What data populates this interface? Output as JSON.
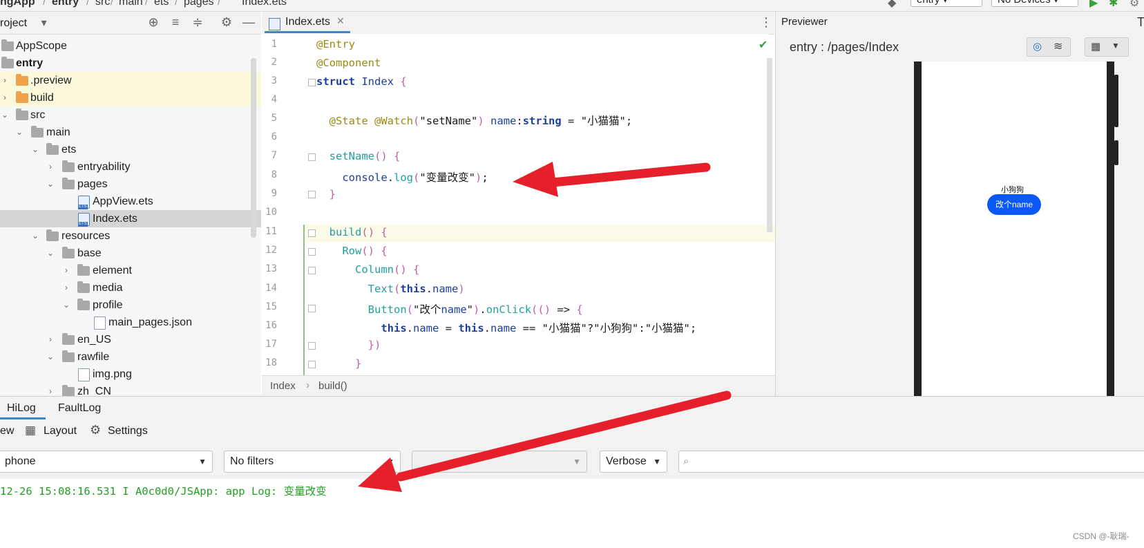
{
  "topbar": {
    "app": "ngApp",
    "module": "entry",
    "path": [
      "src",
      "main",
      "ets",
      "pages"
    ],
    "file": "Index.ets",
    "run_config": "entry",
    "device": "No Devices"
  },
  "project": {
    "title": "roject",
    "dropdown": "▾"
  },
  "tree": [
    {
      "label": "AppScope",
      "icon": "folder-icon",
      "twisty": ""
    },
    {
      "label": "entry",
      "icon": "folder-icon",
      "twisty": "",
      "bold": true
    },
    {
      "label": ".preview",
      "icon": "folder-orange-icon",
      "twisty": "›"
    },
    {
      "label": "build",
      "icon": "folder-orange-icon",
      "twisty": "›"
    },
    {
      "label": "src",
      "icon": "folder-icon",
      "twisty": "⌄"
    },
    {
      "label": "main",
      "icon": "folder-icon",
      "twisty": "⌄"
    },
    {
      "label": "ets",
      "icon": "folder-icon",
      "twisty": "⌄"
    },
    {
      "label": "entryability",
      "icon": "folder-icon",
      "twisty": "›"
    },
    {
      "label": "pages",
      "icon": "folder-icon",
      "twisty": "⌄"
    },
    {
      "label": "AppView.ets",
      "icon": "ets-file-icon",
      "twisty": ""
    },
    {
      "label": "Index.ets",
      "icon": "ets-file-icon",
      "twisty": "",
      "selected": true
    },
    {
      "label": "resources",
      "icon": "folder-icon",
      "twisty": "⌄"
    },
    {
      "label": "base",
      "icon": "folder-icon",
      "twisty": "⌄"
    },
    {
      "label": "element",
      "icon": "folder-icon",
      "twisty": "›"
    },
    {
      "label": "media",
      "icon": "folder-icon",
      "twisty": "›"
    },
    {
      "label": "profile",
      "icon": "folder-icon",
      "twisty": "⌄"
    },
    {
      "label": "main_pages.json",
      "icon": "json-file-icon",
      "twisty": ""
    },
    {
      "label": "en_US",
      "icon": "folder-icon",
      "twisty": "›"
    },
    {
      "label": "rawfile",
      "icon": "folder-icon",
      "twisty": "⌄"
    },
    {
      "label": "img.png",
      "icon": "image-file-icon",
      "twisty": ""
    },
    {
      "label": "zh_CN",
      "icon": "folder-icon",
      "twisty": "›"
    }
  ],
  "editor": {
    "tab": "Index.ets",
    "lines": [
      "@Entry",
      "@Component",
      "struct Index {",
      "",
      "  @State @Watch(\"setName\") name:string = \"小猫猫\";",
      "",
      "  setName() {",
      "    console.log(\"变量改变\");",
      "  }",
      "",
      "  build() {",
      "    Row() {",
      "      Column() {",
      "        Text(this.name)",
      "        Button(\"改个name\").onClick(() => {",
      "          this.name = this.name == \"小猫猫\"?\"小狗狗\":\"小猫猫\";",
      "        })",
      "      }"
    ],
    "breadcrumbs": [
      "Index",
      "build()"
    ]
  },
  "previewer": {
    "title": "Previewer",
    "path": "entry : /pages/Index",
    "screen_text": "小狗狗",
    "screen_button": "改个name"
  },
  "log": {
    "tabs": [
      "HiLog",
      "FaultLog"
    ],
    "toolbar": [
      "ew",
      "Layout",
      "Settings"
    ],
    "device_filter": "phone",
    "filter": "No filters",
    "level": "Verbose",
    "search_placeholder": "",
    "line": "12-26 15:08:16.531 I A0c0d0/JSApp: app Log: 变量改变"
  },
  "watermark": "CSDN @-耿瑞-",
  "colors": {
    "arrow": "#e5202b",
    "log_text": "#22a022",
    "button": "#0a59f7"
  }
}
